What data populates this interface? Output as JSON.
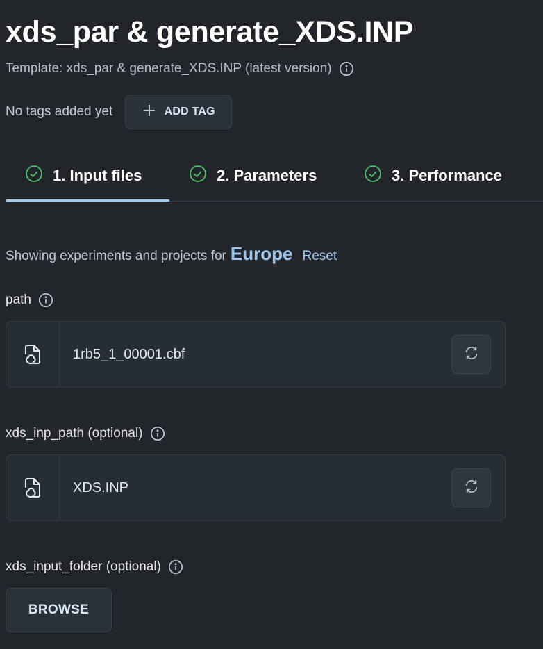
{
  "header": {
    "title": "xds_par & generate_XDS.INP",
    "subtitle": "Template: xds_par & generate_XDS.INP (latest version)"
  },
  "tags": {
    "empty_text": "No tags added yet",
    "add_label": "ADD TAG"
  },
  "tabs": [
    {
      "label": "1. Input files",
      "status": "complete",
      "active": true
    },
    {
      "label": "2. Parameters",
      "status": "complete",
      "active": false
    },
    {
      "label": "3. Performance",
      "status": "complete",
      "active": false
    }
  ],
  "region": {
    "prefix": "Showing experiments and projects for",
    "name": "Europe",
    "reset_label": "Reset"
  },
  "fields": {
    "path": {
      "label": "path",
      "value": "1rb5_1_00001.cbf"
    },
    "xds_inp_path": {
      "label": "xds_inp_path (optional)",
      "value": "XDS.INP"
    },
    "xds_input_folder": {
      "label": "xds_input_folder (optional)",
      "browse_label": "BROWSE"
    }
  },
  "colors": {
    "background": "#22262b",
    "accent": "#9fc8ef",
    "success": "#4cc26b"
  },
  "icons": {
    "info": "info-icon",
    "add": "plus-icon",
    "tab_status": "check-circle-icon",
    "file": "file-icon",
    "refresh": "refresh-icon"
  }
}
